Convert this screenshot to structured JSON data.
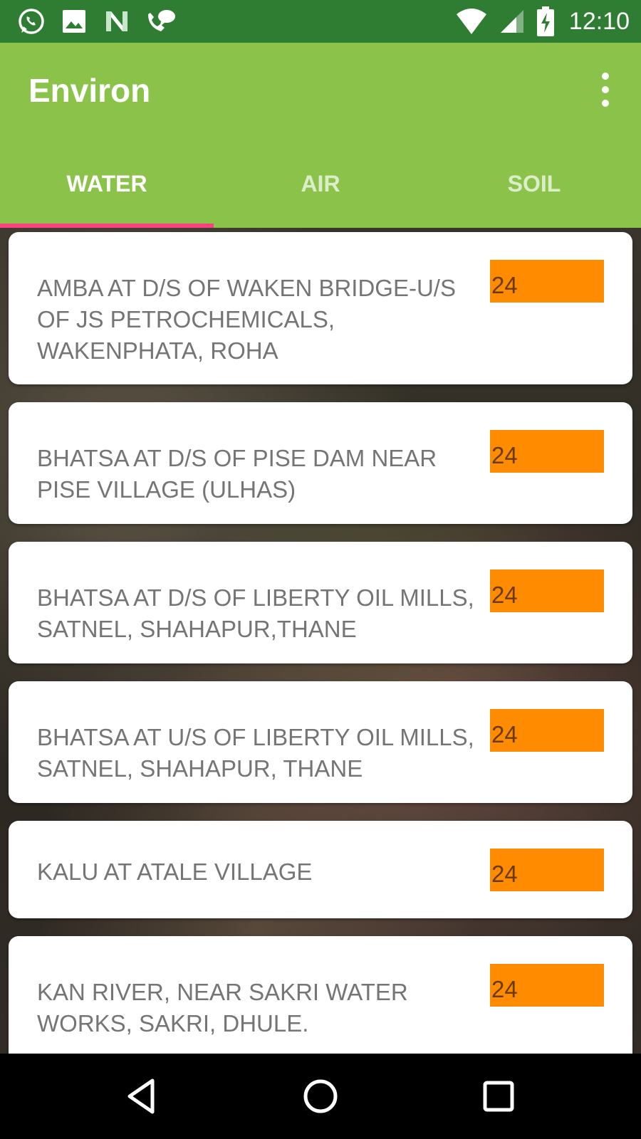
{
  "status_bar": {
    "time": "12:10",
    "left_icons": [
      "whatsapp-icon",
      "image-icon",
      "n-notification-icon",
      "phone-message-icon"
    ],
    "right_icons": [
      "wifi-icon",
      "signal-icon",
      "battery-charging-icon"
    ]
  },
  "app_bar": {
    "title": "Environ",
    "menu_icon": "more-vert-icon"
  },
  "tabs": [
    {
      "label": "WATER",
      "active": true
    },
    {
      "label": "AIR",
      "active": false
    },
    {
      "label": "SOIL",
      "active": false
    }
  ],
  "stations": [
    {
      "name": "AMBA AT D/S OF WAKEN BRIDGE-U/S OF JS PETROCHEMICALS, WAKENPHATA, ROHA",
      "value": "24"
    },
    {
      "name": "BHATSA AT D/S OF PISE DAM NEAR PISE VILLAGE (ULHAS)",
      "value": "24"
    },
    {
      "name": "BHATSA AT D/S OF LIBERTY OIL MILLS, SATNEL, SHAHAPUR,THANE",
      "value": "24"
    },
    {
      "name": "BHATSA AT U/S OF LIBERTY OIL MILLS, SATNEL, SHAHAPUR, THANE",
      "value": "24"
    },
    {
      "name": "KALU AT ATALE VILLAGE",
      "value": "24"
    },
    {
      "name": "KAN RIVER, NEAR SAKRI WATER WORKS, SAKRI, DHULE.",
      "value": "24"
    }
  ],
  "colors": {
    "status_bar": "#2e7d32",
    "app_bar": "#8bc34a",
    "tab_indicator": "#ff4081",
    "badge": "#ff8c00",
    "card_text": "#757575"
  },
  "nav_bar": {
    "buttons": [
      "back-icon",
      "home-icon",
      "recents-icon"
    ]
  }
}
